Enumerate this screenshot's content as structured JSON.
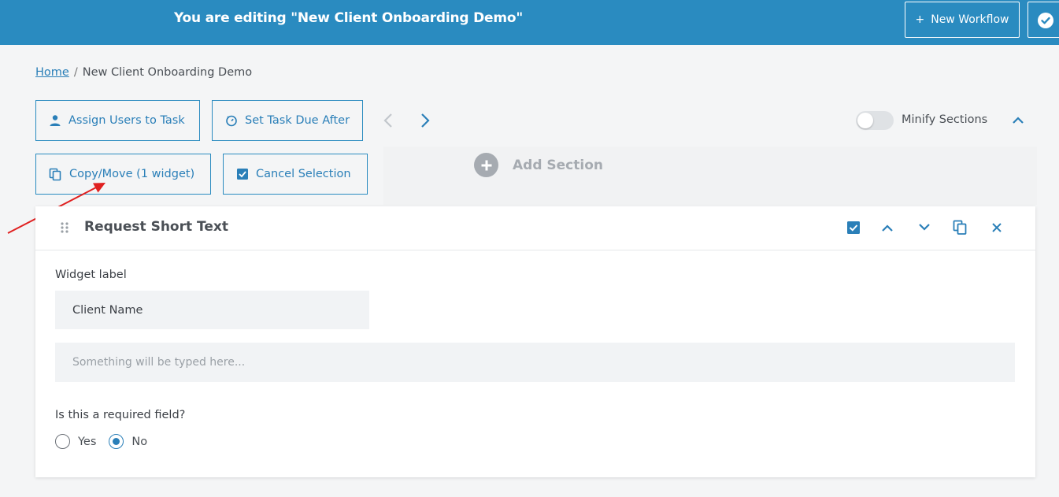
{
  "header": {
    "title": "You are editing \"New Client Onboarding Demo\"",
    "new_workflow_label": "New Workflow",
    "new_workflow_prefix": "+"
  },
  "breadcrumb": {
    "home": "Home",
    "separator": "/",
    "current": "New Client Onboarding Demo"
  },
  "toolbar": {
    "assign_users_label": "Assign Users to Task",
    "set_due_label": "Set Task Due After",
    "copy_move_label": "Copy/Move (1 widget)",
    "cancel_selection_label": "Cancel Selection",
    "minify_label": "Minify Sections",
    "minify_enabled": false,
    "add_section_label": "Add Section"
  },
  "widget": {
    "title": "Request Short Text",
    "label_caption": "Widget label",
    "label_value": "Client Name",
    "placeholder": "Something will be typed here...",
    "required_question": "Is this a required field?",
    "options": [
      {
        "label": "Yes",
        "checked": false
      },
      {
        "label": "No",
        "checked": true
      }
    ]
  },
  "colors": {
    "brand": "#2a8bc0",
    "link": "#2a7fb8",
    "annotation_arrow": "#e02020"
  }
}
